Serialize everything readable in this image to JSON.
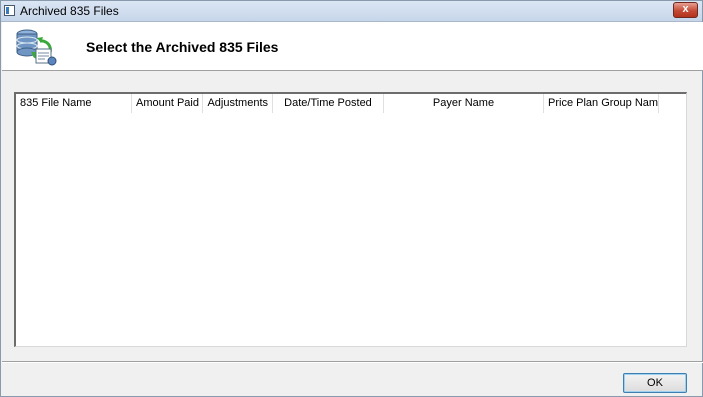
{
  "window": {
    "title": "Archived 835 Files",
    "close_label": "x"
  },
  "header": {
    "title": "Select the Archived 835 Files",
    "icon": "database-refresh-icon"
  },
  "list": {
    "columns": [
      "835 File Name",
      "Amount Paid",
      "Adjustments",
      "Date/Time Posted",
      "Payer Name",
      "Price Plan Group Name"
    ],
    "rows": []
  },
  "footer": {
    "ok_label": "OK"
  },
  "colors": {
    "dialog_background": "#f0f0f0",
    "header_background": "#ffffff",
    "close_button": "#c44a35",
    "ok_button_border": "#3c7fb1"
  }
}
